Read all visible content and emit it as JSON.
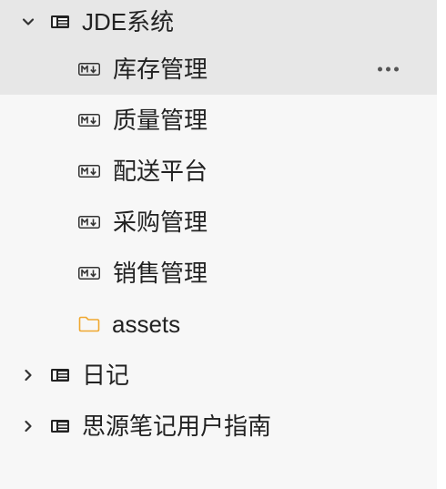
{
  "tree": {
    "root_notebook": {
      "label": "JDE系统",
      "expanded": true,
      "icon": "notebook-icon",
      "children": [
        {
          "label": "库存管理",
          "icon": "markdown-doc-icon",
          "active": true
        },
        {
          "label": "质量管理",
          "icon": "markdown-doc-icon"
        },
        {
          "label": "配送平台",
          "icon": "markdown-doc-icon"
        },
        {
          "label": "采购管理",
          "icon": "markdown-doc-icon"
        },
        {
          "label": "销售管理",
          "icon": "markdown-doc-icon"
        },
        {
          "label": "assets",
          "icon": "folder-icon"
        }
      ]
    },
    "other_notebooks": [
      {
        "label": "日记",
        "expanded": false,
        "icon": "notebook-icon"
      },
      {
        "label": "思源笔记用户指南",
        "expanded": false,
        "icon": "notebook-icon"
      }
    ]
  },
  "colors": {
    "panel_bg": "#f7f7f7",
    "active_bg": "#e7e7e7",
    "folder": "#f0a830",
    "text": "#222222"
  }
}
